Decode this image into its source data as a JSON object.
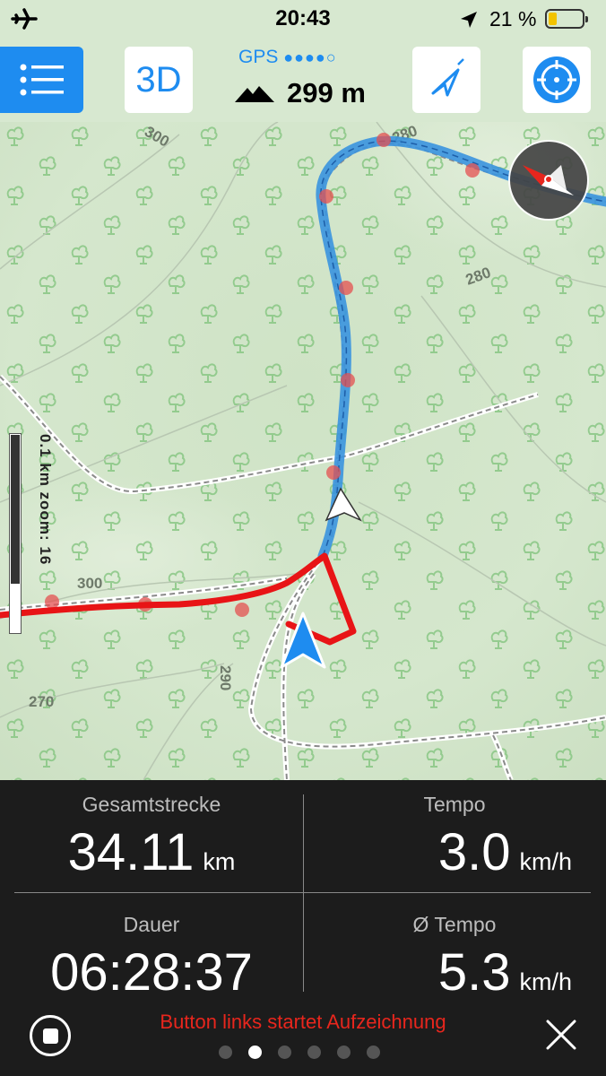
{
  "status": {
    "time": "20:43",
    "battery_percent": "21 %"
  },
  "toolbar": {
    "btn_3d": "3D",
    "gps_label": "GPS",
    "gps_signal": "●●●●○",
    "altitude": "299 m"
  },
  "map": {
    "scale_label": "0.1 km   zoom: 16",
    "contour_labels": [
      "300",
      "280",
      "280",
      "300",
      "270",
      "290"
    ]
  },
  "stats": {
    "distance": {
      "label": "Gesamtstrecke",
      "value": "34.11",
      "unit": "km"
    },
    "speed": {
      "label": "Tempo",
      "value": "3.0",
      "unit": "km/h"
    },
    "duration": {
      "label": "Dauer",
      "value": "06:28:37"
    },
    "avg_speed": {
      "label": "Ø Tempo",
      "value": "5.3",
      "unit": "km/h"
    }
  },
  "hint": "Button links startet Aufzeichnung",
  "pager": {
    "count": 6,
    "active": 1
  },
  "colors": {
    "accent": "#1e8cf0",
    "track_red": "#e81416",
    "route_blue": "#3a93df",
    "map_bg": "#d4e6cc"
  }
}
